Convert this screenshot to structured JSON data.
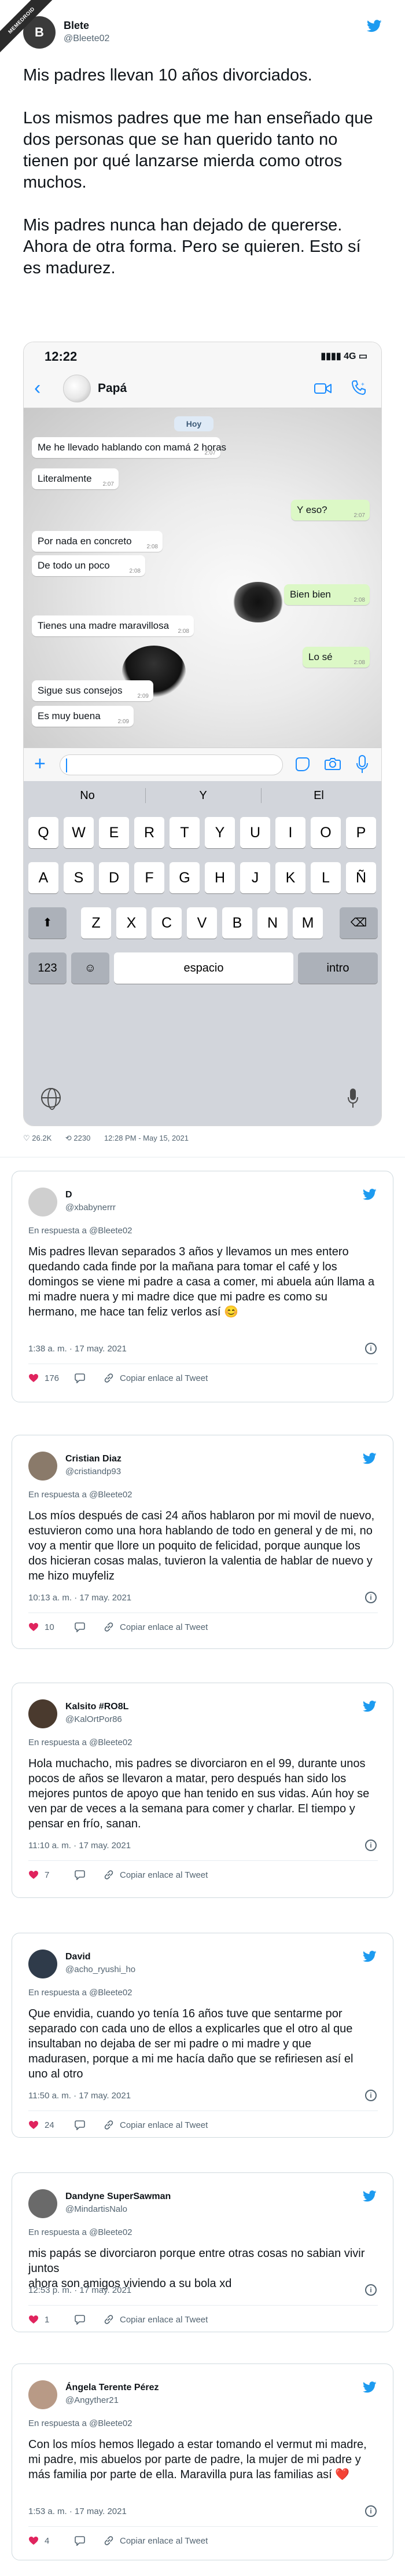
{
  "watermark": {
    "text": "MEMEDROID"
  },
  "main_tweet": {
    "author_name": "Blete",
    "author_handle": "@Bleete02",
    "avatar_initial": "B",
    "paragraphs": [
      "Mis padres llevan 10 años divorciados.",
      "Los mismos padres que me han enseñado que dos personas que se han querido tanto no tienen por qué lanzarse mierda como otros muchos.",
      "Mis padres nunca han dejado de quererse. Ahora de otra forma. Pero se quieren. Esto sí es madurez."
    ],
    "likes": "26.2K",
    "retweets": "2230",
    "timestamp": "12:28 PM - May 15, 2021"
  },
  "phone": {
    "status_time": "12:22",
    "status_right": "4G",
    "contact_name": "Papá",
    "date_label": "Hoy",
    "messages": [
      {
        "dir": "in",
        "text": "Me he llevado hablando con mamá 2 horas",
        "time": "2:07"
      },
      {
        "dir": "in",
        "text": "Literalmente",
        "time": "2:07"
      },
      {
        "dir": "out",
        "text": "Y eso?",
        "time": "2:07"
      },
      {
        "dir": "in",
        "text": "Por nada en concreto",
        "time": "2:08"
      },
      {
        "dir": "in",
        "text": "De todo un poco",
        "time": "2:08"
      },
      {
        "dir": "out",
        "text": "Bien bien",
        "time": "2:08"
      },
      {
        "dir": "in",
        "text": "Tienes una madre maravillosa",
        "time": "2:08"
      },
      {
        "dir": "out",
        "text": "Lo sé",
        "time": "2:08"
      },
      {
        "dir": "in",
        "text": "Sigue sus consejos",
        "time": "2:09"
      },
      {
        "dir": "in",
        "text": "Es muy buena",
        "time": "2:09"
      }
    ],
    "suggestions": [
      "No",
      "Y",
      "El"
    ],
    "keyboard": {
      "row1": [
        "Q",
        "W",
        "E",
        "R",
        "T",
        "Y",
        "U",
        "I",
        "O",
        "P"
      ],
      "row2": [
        "A",
        "S",
        "D",
        "F",
        "G",
        "H",
        "J",
        "K",
        "L",
        "Ñ"
      ],
      "row3": [
        "Z",
        "X",
        "C",
        "V",
        "B",
        "N",
        "M"
      ],
      "shift": "⬆",
      "backspace": "⌫",
      "numbers": "123",
      "emoji": "☺",
      "space": "espacio",
      "enter": "intro"
    }
  },
  "replies": [
    {
      "name": "D",
      "handle": "@xbabynerrr",
      "in_reply_to": "En respuesta a @Bleete02",
      "text": "Mis padres llevan separados 3 años y llevamos un mes entero quedando cada finde por la mañana para tomar el café y los domingos se viene mi padre a casa a comer, mi abuela aún llama a mi madre nuera y mi madre dice que mi padre es como su hermano, me hace tan feliz verlos así 😊",
      "time": "1:38 a. m. · 17 may. 2021",
      "likes": "176",
      "copy_link": "Copiar enlace al Tweet",
      "avatar_color": "#cfcfcf"
    },
    {
      "name": "Cristian Diaz",
      "handle": "@cristiandp93",
      "in_reply_to": "En respuesta a @Bleete02",
      "text": "Los míos después de casi 24 años hablaron por mi movil de nuevo, estuvieron como una hora hablando de todo en general y de mi, no voy a mentir que llore un poquito de felicidad, porque aunque los dos hicieran cosas malas, tuvieron la valentia de hablar de nuevo y me hizo muyfeliz",
      "time": "10:13 a. m. · 17 may. 2021",
      "likes": "10",
      "copy_link": "Copiar enlace al Tweet",
      "avatar_color": "#8a7a6a"
    },
    {
      "name": "Kalsito #RO8L",
      "handle": "@KalOrtPor86",
      "in_reply_to": "En respuesta a @Bleete02",
      "text": "Hola muchacho, mis padres se divorciaron en el 99, durante unos pocos de años se llevaron a matar, pero después han sido los mejores puntos de apoyo que han tenido en sus vidas. Aún hoy se ven par de veces a la semana para comer y charlar. El tiempo y pensar en frío, sanan.",
      "time": "11:10 a. m. · 17 may. 2021",
      "likes": "7",
      "copy_link": "Copiar enlace al Tweet",
      "avatar_color": "#4a3a2e"
    },
    {
      "name": "David",
      "handle": "@acho_ryushi_ho",
      "in_reply_to": "En respuesta a @Bleete02",
      "text": "Que envidia, cuando yo tenía 16 años tuve que sentarme por separado con cada uno de ellos a explicarles que el otro al que insultaban no dejaba de ser mi padre o mi madre y que madurasen, porque a mi me hacía daño que se refiriesen así el uno al otro",
      "time": "11:50 a. m. · 17 may. 2021",
      "likes": "24",
      "copy_link": "Copiar enlace al Tweet",
      "avatar_color": "#2f3b4a"
    },
    {
      "name": "Dandyne SuperSawman",
      "handle": "@MindartisNalo",
      "in_reply_to": "En respuesta a @Bleete02",
      "text": "mis papás se divorciaron porque entre otras cosas no sabian vivir juntos\nahora son amigos viviendo a su bola xd",
      "time": "12:53 p. m. · 17 may. 2021",
      "likes": "1",
      "copy_link": "Copiar enlace al Tweet",
      "avatar_color": "#6a6a6a"
    },
    {
      "name": "Ángela Terente Pérez",
      "handle": "@Angyther21",
      "in_reply_to": "En respuesta a @Bleete02",
      "text": "Con los míos hemos llegado a estar tomando el vermut mi madre, mi padre, mis abuelos por parte de padre, la mujer de mi padre y más familia por parte de ella. Maravilla pura las familias así ❤️",
      "time": "1:53 a. m. · 17 may. 2021",
      "likes": "4",
      "copy_link": "Copiar enlace al Tweet",
      "avatar_color": "#b89a86"
    }
  ],
  "colors": {
    "twitter_blue": "#1d9bf0",
    "text_primary": "#0f1419",
    "text_secondary": "#536471",
    "bubble_out": "#dcf8c6",
    "bubble_in": "#ffffff",
    "heart_red": "#e0245e"
  }
}
